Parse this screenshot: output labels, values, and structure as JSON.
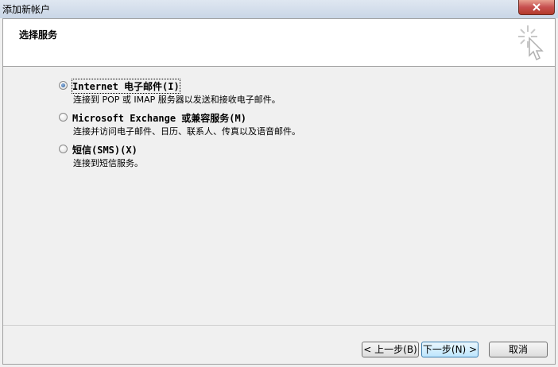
{
  "window": {
    "title": "添加新帐户"
  },
  "header": {
    "heading": "选择服务"
  },
  "options": [
    {
      "label": "Internet 电子邮件(I)",
      "description": "连接到 POP 或 IMAP 服务器以发送和接收电子邮件。",
      "selected": true
    },
    {
      "label": "Microsoft Exchange 或兼容服务(M)",
      "description": "连接并访问电子邮件、日历、联系人、传真以及语音邮件。",
      "selected": false
    },
    {
      "label": "短信(SMS)(X)",
      "description": "连接到短信服务。",
      "selected": false
    }
  ],
  "buttons": {
    "back": "< 上一步(B)",
    "next": "下一步(N) >",
    "cancel": "取消"
  },
  "icons": {
    "close": "close-icon",
    "wizard": "wizard-sparkle-cursor-icon"
  }
}
